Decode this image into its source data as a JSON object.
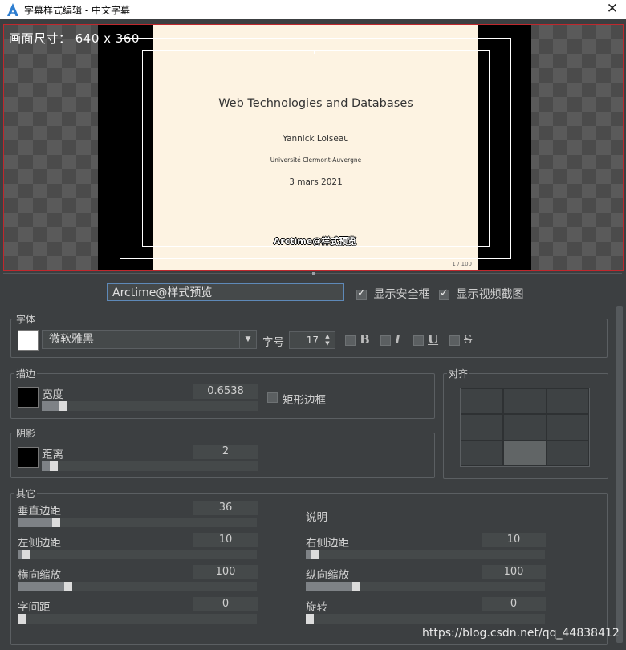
{
  "window": {
    "title": "字幕样式编辑 - 中文字幕",
    "close": "✕"
  },
  "preview": {
    "canvas_size": "画面尺寸：  640 x 360",
    "slide": {
      "title": "Web Technologies and Databases",
      "author": "Yannick Loiseau",
      "affiliation": "Université Clermont-Auvergne",
      "date": "3 mars 2021",
      "page": "1 / 100"
    },
    "subtitle_sample": "Arctime@样式预览"
  },
  "sample_text": "Arctime@样式预览",
  "options": {
    "show_safe_frame": {
      "label": "显示安全框",
      "checked": true
    },
    "show_video_frame": {
      "label": "显示视频截图",
      "checked": true
    }
  },
  "font": {
    "legend": "字体",
    "color": "#ffffff",
    "family": "微软雅黑",
    "size_label": "字号",
    "size": "17",
    "bold": "B",
    "italic": "I",
    "underline": "U",
    "strike": "S"
  },
  "stroke": {
    "legend": "描边",
    "color": "#000000",
    "width_label": "宽度",
    "width": "0.6538",
    "width_level": 0.08,
    "rect_border_label": "矩形边框",
    "rect_border": false
  },
  "shadow": {
    "legend": "阴影",
    "color": "#000000",
    "distance_label": "距离",
    "distance": "2",
    "distance_level": 0.04
  },
  "align": {
    "legend": "对齐",
    "selected": 7
  },
  "other": {
    "legend": "其它",
    "vmargin_label": "垂直边距",
    "vmargin": "36",
    "vmargin_level": 0.15,
    "note_label": "说明",
    "lmargin_label": "左侧边距",
    "lmargin": "10",
    "lmargin_level": 0.02,
    "rmargin_label": "右侧边距",
    "rmargin": "10",
    "rmargin_level": 0.02,
    "hscale_label": "横向缩放",
    "hscale": "100",
    "hscale_level": 0.2,
    "vscale_label": "纵向缩放",
    "vscale": "100",
    "vscale_level": 0.2,
    "spacing_label": "字间距",
    "spacing": "0",
    "spacing_level": 0.0,
    "rotate_label": "旋转",
    "rotate": "0",
    "rotate_level": 0.0
  },
  "watermark": "https://blog.csdn.net/qq_44838412"
}
